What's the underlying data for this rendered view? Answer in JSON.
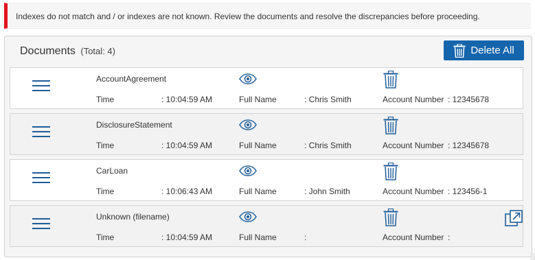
{
  "alert": {
    "message": "Indexes do not match and / or indexes are not known. Review the documents and resolve the discrepancies before proceeding.",
    "accent_color": "#e0141e"
  },
  "panel": {
    "title": "Documents",
    "total": "(Total: 4)",
    "delete_all_label": "Delete All",
    "button_color": "#1565ad"
  },
  "documents": [
    {
      "name": "AccountAgreement",
      "time_label": "Time",
      "time_value": ": 10:04:59 AM",
      "name_label": "Full Name",
      "name_value": ": Chris Smith",
      "account_label": "Account Number",
      "account_value": ": 12345678",
      "icons": [
        "drag-handle-icon",
        "eye-icon",
        "trash-icon"
      ]
    },
    {
      "name": "DisclosureStatement",
      "time_label": "Time",
      "time_value": ": 10:04:59 AM",
      "name_label": "Full Name",
      "name_value": ": Chris Smith",
      "account_label": "Account Number",
      "account_value": ": 12345678",
      "icons": [
        "drag-handle-icon",
        "eye-icon",
        "trash-icon"
      ]
    },
    {
      "name": "CarLoan",
      "time_label": "Time",
      "time_value": ": 10:06:43 AM",
      "name_label": "Full Name",
      "name_value": ": John Smith",
      "account_label": "Account Number",
      "account_value": ": 123456-1",
      "icons": [
        "drag-handle-icon",
        "eye-icon",
        "trash-icon"
      ]
    },
    {
      "name": "Unknown (filename)",
      "time_label": "Time",
      "time_value": ": 10:04:59 AM",
      "name_label": "Full Name",
      "name_value": ":",
      "account_label": "Account Number",
      "account_value": ":",
      "icons": [
        "drag-handle-icon",
        "eye-icon",
        "trash-icon",
        "external-link-icon"
      ]
    }
  ]
}
